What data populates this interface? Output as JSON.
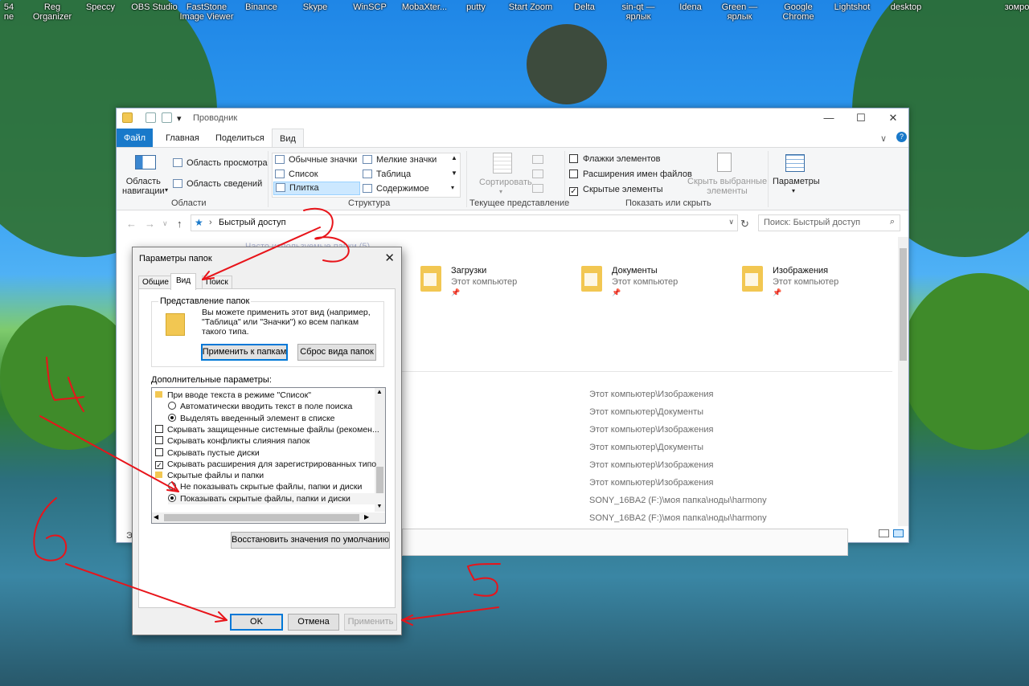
{
  "desktop": {
    "icons": [
      "54\nne",
      "Reg\nOrganizer",
      "Speccy",
      "OBS Studio",
      "FastStone\nImage Viewer",
      "Binance",
      "Skype",
      "WinSCP",
      "MobaXter...",
      "putty",
      "Start Zoom",
      "Delta",
      "sin-qt —\nярлык",
      "Idena",
      "Green —\nярлык",
      "Google\nChrome",
      "Lightshot",
      "desktop",
      "зомро"
    ]
  },
  "explorer": {
    "title": "Проводник",
    "tabs": [
      "Файл",
      "Главная",
      "Поделиться",
      "Вид"
    ],
    "ribbon": {
      "nav_pane": "Область\nнавигации",
      "preview_pane": "Область просмотра",
      "details_pane": "Область сведений",
      "group_panes": "Области",
      "layout_items": [
        "Обычные значки",
        "Мелкие значки",
        "Список",
        "Таблица",
        "Плитка",
        "Содержимое"
      ],
      "group_layout": "Структура",
      "sort": "Сортировать",
      "group_current_view": "Текущее представление",
      "checkboxes": [
        {
          "label": "Флажки элементов",
          "checked": false
        },
        {
          "label": "Расширения имен файлов",
          "checked": false
        },
        {
          "label": "Скрытые элементы",
          "checked": true
        }
      ],
      "hide_selected": "Скрыть выбранные\nэлементы",
      "options": "Параметры",
      "group_show_hide": "Показать или скрыть"
    },
    "address": "Быстрый доступ",
    "search_placeholder": "Поиск: Быстрый доступ",
    "section_hint": "Часто используемые папки (5)",
    "folders": [
      {
        "name": "Загрузки",
        "sub": "Этот компьютер"
      },
      {
        "name": "Документы",
        "sub": "Этот компьютер"
      },
      {
        "name": "Изображения",
        "sub": "Этот компьютер"
      }
    ],
    "recent_paths": [
      "Этот компьютер\\Изображения",
      "Этот компьютер\\Документы",
      "Этот компьютер\\Изображения",
      "Этот компьютер\\Документы",
      "Этот компьютер\\Изображения",
      "Этот компьютер\\Изображения",
      "SONY_16BA2 (F:)\\моя папка\\ноды\\harmony",
      "SONY_16BA2 (F:)\\моя папка\\ноды\\harmony"
    ],
    "status_left": "Эл"
  },
  "dialog": {
    "title": "Параметры папок",
    "tabs": [
      "Общие",
      "Вид",
      "Поиск"
    ],
    "folder_view_legend": "Представление папок",
    "folder_view_text": "Вы можете применить этот вид (например, \"Таблица\" или \"Значки\") ко всем папкам такого типа.",
    "apply_to_folders": "Применить к папкам",
    "reset_folders": "Сброс вида папок",
    "advanced_label": "Дополнительные параметры:",
    "tree": [
      {
        "type": "folder",
        "label": "При вводе текста в режиме \"Список\""
      },
      {
        "type": "radio",
        "on": false,
        "label": "Автоматически вводить текст в поле поиска"
      },
      {
        "type": "radio",
        "on": true,
        "label": "Выделять введенный элемент в списке"
      },
      {
        "type": "check",
        "on": false,
        "label": "Скрывать защищенные системные файлы (рекомен..."
      },
      {
        "type": "check",
        "on": false,
        "label": "Скрывать конфликты слияния папок"
      },
      {
        "type": "check",
        "on": false,
        "label": "Скрывать пустые диски"
      },
      {
        "type": "check",
        "on": true,
        "label": "Скрывать расширения для зарегистрированных типо"
      },
      {
        "type": "folder",
        "label": "Скрытые файлы и папки"
      },
      {
        "type": "radio",
        "on": false,
        "label": "Не показывать скрытые файлы, папки и диски"
      },
      {
        "type": "radio",
        "on": true,
        "label": "Показывать скрытые файлы, папки и диски"
      }
    ],
    "restore_defaults": "Восстановить значения по умолчанию",
    "ok": "OK",
    "cancel": "Отмена",
    "apply": "Применить"
  },
  "annotations": {
    "color": "#e8141a"
  },
  "colors": {
    "file_tab": "#1979ca",
    "focus": "#0078d7"
  }
}
